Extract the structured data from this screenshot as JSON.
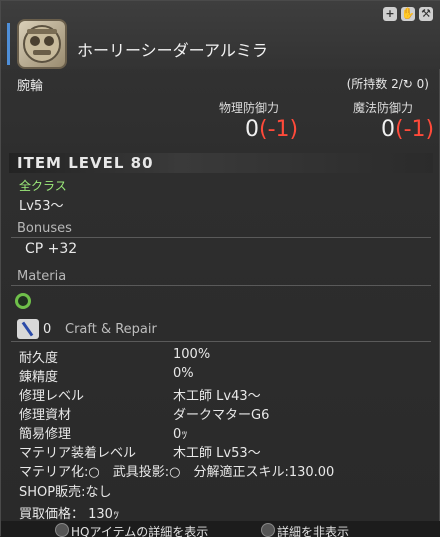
{
  "item": {
    "name": "ホーリーシーダーアルミラ",
    "category": "腕輪",
    "owned": "(所持数 2/",
    "owned_suffix": " 0)"
  },
  "defense": {
    "physical_label": "物理防御力",
    "magic_label": "魔法防御力",
    "physical_value": "0",
    "physical_diff": "(-1)",
    "magic_value": "0",
    "magic_diff": "(-1)"
  },
  "item_level": "ITEM LEVEL 80",
  "classes": "全クラス",
  "level": "Lv53～",
  "bonuses": {
    "title": "Bonuses",
    "items": [
      "CP +32"
    ]
  },
  "materia": {
    "title": "Materia"
  },
  "repair": {
    "count": "0",
    "title": "Craft & Repair"
  },
  "stats": [
    {
      "k": "耐久度",
      "v": "100%"
    },
    {
      "k": "錬精度",
      "v": "0%"
    },
    {
      "k": "修理レベル",
      "v": "木工師 Lv43～"
    },
    {
      "k": "修理資材",
      "v": "ダークマターG6"
    },
    {
      "k": "簡易修理",
      "v": "0ｯ"
    },
    {
      "k": "マテリア装着レベル",
      "v": "木工師 Lv53～"
    }
  ],
  "flags_line": "マテリア化:○　武具投影:○　分解適正スキル:130.00",
  "shop_line": "SHOP販売:なし",
  "sell_line": "買取価格： 130ｯ",
  "bottom": {
    "hq_label": "HQアイテムの詳細を表示",
    "hide_label": "詳細を非表示"
  },
  "colors": {
    "accent": "#4f8fd8",
    "diff_red": "#ff4a3a",
    "class_green": "#9cea7a"
  }
}
